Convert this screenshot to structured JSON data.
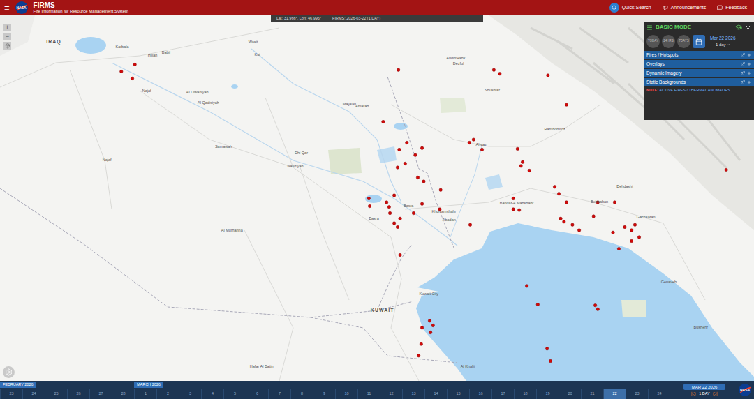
{
  "header": {
    "menu_icon": "≡",
    "logo": "NASA",
    "title": "FIRMS",
    "subtitle": "Fire Information for Resource Management System",
    "links": [
      "Quick Search",
      "Announcements",
      "Feedback"
    ]
  },
  "info_bar": {
    "coords": "Lat: 31.966°, Lon: 46.996°",
    "layer": "FIRMS: 2026-03-22 (1 DAY)"
  },
  "zoom": {
    "in": "+",
    "out": "−"
  },
  "panel": {
    "title": "BASIC MODE",
    "range_buttons": [
      {
        "label": "TODAY",
        "selected": false
      },
      {
        "label": "24HRS",
        "selected": false
      },
      {
        "label": "7DAYS",
        "selected": false
      }
    ],
    "calendar_selected": true,
    "date": "Mar 22 2026",
    "span": "1 day",
    "sections": [
      "Fires / Hotspots",
      "Overlays",
      "Dynamic Imagery",
      "Static Backgrounds"
    ],
    "note_label": "NOTE:",
    "note_text": "ACTIVE FIRES / THERMAL ANOMALIES"
  },
  "labels": [
    {
      "text": "IRAQ",
      "kind": "country",
      "lat": 32.68,
      "lon": 43.21
    },
    {
      "text": "Karbala",
      "kind": "city",
      "lat": 32.6,
      "lon": 44.02
    },
    {
      "text": "Hillah",
      "kind": "city",
      "lat": 32.49,
      "lon": 44.38
    },
    {
      "text": "Babil",
      "kind": "city",
      "lat": 32.53,
      "lon": 44.54
    },
    {
      "text": "Najaf",
      "kind": "city",
      "lat": 32.03,
      "lon": 44.31
    },
    {
      "text": "Al Diwaniyah",
      "kind": "city",
      "lat": 32.01,
      "lon": 44.91
    },
    {
      "text": "Al Qadisiyah",
      "kind": "city",
      "lat": 31.88,
      "lon": 45.04
    },
    {
      "text": "Wasit",
      "kind": "city",
      "lat": 32.66,
      "lon": 45.57
    },
    {
      "text": "Kut",
      "kind": "city",
      "lat": 32.5,
      "lon": 45.62
    },
    {
      "text": "Samawah",
      "kind": "city",
      "lat": 31.31,
      "lon": 45.22
    },
    {
      "text": "Dhi Qar",
      "kind": "city",
      "lat": 31.23,
      "lon": 46.14
    },
    {
      "text": "Nasiriyah",
      "kind": "city",
      "lat": 31.06,
      "lon": 46.07
    },
    {
      "text": "Najaf",
      "kind": "city",
      "lat": 31.14,
      "lon": 43.84
    },
    {
      "text": "Al Muthanna",
      "kind": "city",
      "lat": 30.23,
      "lon": 45.32
    },
    {
      "text": "Maysan",
      "kind": "city",
      "lat": 31.86,
      "lon": 46.71
    },
    {
      "text": "Amarah",
      "kind": "city",
      "lat": 31.83,
      "lon": 46.86
    },
    {
      "text": "Basra",
      "kind": "city",
      "lat": 30.55,
      "lon": 47.41
    },
    {
      "text": "Basra",
      "kind": "city",
      "lat": 30.38,
      "lon": 47.0
    },
    {
      "text": "Khorramshahr",
      "kind": "city",
      "lat": 30.47,
      "lon": 47.83
    },
    {
      "text": "Abadan",
      "kind": "city",
      "lat": 30.37,
      "lon": 47.89
    },
    {
      "text": "Ahvaz",
      "kind": "city",
      "lat": 31.34,
      "lon": 48.27
    },
    {
      "text": "Bandar-e Mahshahr",
      "kind": "city",
      "lat": 30.58,
      "lon": 48.69
    },
    {
      "text": "Andimeshk",
      "kind": "city",
      "lat": 32.46,
      "lon": 47.97
    },
    {
      "text": "Dezful",
      "kind": "city",
      "lat": 32.38,
      "lon": 48.0
    },
    {
      "text": "Shushtar",
      "kind": "city",
      "lat": 32.04,
      "lon": 48.4
    },
    {
      "text": "KUWAIT",
      "kind": "country",
      "lat": 29.21,
      "lon": 47.1
    },
    {
      "text": "Kuwait City",
      "kind": "city",
      "lat": 29.41,
      "lon": 47.65
    },
    {
      "text": "Al Khafji",
      "kind": "city",
      "lat": 28.47,
      "lon": 48.11
    },
    {
      "text": "Hafar Al Batin",
      "kind": "city",
      "lat": 28.47,
      "lon": 45.67
    },
    {
      "text": "Bushehr",
      "kind": "city",
      "lat": 28.98,
      "lon": 50.87
    },
    {
      "text": "Behbahan",
      "kind": "city",
      "lat": 30.6,
      "lon": 49.67
    },
    {
      "text": "Ramhormoz",
      "kind": "city",
      "lat": 31.54,
      "lon": 49.14
    },
    {
      "text": "Dehdasht",
      "kind": "city",
      "lat": 30.8,
      "lon": 49.97
    },
    {
      "text": "Gachsaran",
      "kind": "city",
      "lat": 30.4,
      "lon": 50.22
    },
    {
      "text": "Genaveh",
      "kind": "city",
      "lat": 29.56,
      "lon": 50.49
    }
  ],
  "fires": [
    {
      "lat": 32.29,
      "lon": 44.01
    },
    {
      "lat": 32.38,
      "lon": 44.17
    },
    {
      "lat": 32.2,
      "lon": 44.14
    },
    {
      "lat": 32.31,
      "lon": 47.29
    },
    {
      "lat": 31.64,
      "lon": 47.11
    },
    {
      "lat": 31.28,
      "lon": 47.3
    },
    {
      "lat": 31.37,
      "lon": 47.39
    },
    {
      "lat": 31.21,
      "lon": 47.49
    },
    {
      "lat": 31.3,
      "lon": 47.57
    },
    {
      "lat": 31.05,
      "lon": 47.28
    },
    {
      "lat": 31.1,
      "lon": 47.37
    },
    {
      "lat": 30.92,
      "lon": 47.52
    },
    {
      "lat": 30.87,
      "lon": 47.59
    },
    {
      "lat": 30.76,
      "lon": 47.79
    },
    {
      "lat": 31.37,
      "lon": 48.13
    },
    {
      "lat": 31.41,
      "lon": 48.18
    },
    {
      "lat": 31.28,
      "lon": 48.28
    },
    {
      "lat": 32.31,
      "lon": 48.42
    },
    {
      "lat": 32.26,
      "lon": 48.49
    },
    {
      "lat": 31.29,
      "lon": 48.7
    },
    {
      "lat": 31.07,
      "lon": 48.74
    },
    {
      "lat": 31.12,
      "lon": 48.76
    },
    {
      "lat": 31.01,
      "lon": 48.84
    },
    {
      "lat": 30.51,
      "lon": 47.78
    },
    {
      "lat": 30.65,
      "lon": 46.94
    },
    {
      "lat": 30.55,
      "lon": 46.95
    },
    {
      "lat": 30.6,
      "lon": 47.15
    },
    {
      "lat": 30.54,
      "lon": 47.18
    },
    {
      "lat": 30.46,
      "lon": 47.19
    },
    {
      "lat": 30.33,
      "lon": 47.24
    },
    {
      "lat": 30.28,
      "lon": 47.28
    },
    {
      "lat": 30.39,
      "lon": 47.31
    },
    {
      "lat": 30.69,
      "lon": 47.24
    },
    {
      "lat": 30.46,
      "lon": 47.47
    },
    {
      "lat": 30.58,
      "lon": 47.57
    },
    {
      "lat": 30.31,
      "lon": 48.14
    },
    {
      "lat": 30.51,
      "lon": 48.65
    },
    {
      "lat": 30.65,
      "lon": 48.65
    },
    {
      "lat": 30.5,
      "lon": 48.72
    },
    {
      "lat": 30.8,
      "lon": 49.14
    },
    {
      "lat": 30.71,
      "lon": 49.19
    },
    {
      "lat": 30.39,
      "lon": 49.21
    },
    {
      "lat": 30.35,
      "lon": 49.25
    },
    {
      "lat": 30.6,
      "lon": 49.28
    },
    {
      "lat": 30.31,
      "lon": 49.35
    },
    {
      "lat": 30.24,
      "lon": 49.43
    },
    {
      "lat": 30.42,
      "lon": 49.6
    },
    {
      "lat": 30.6,
      "lon": 49.65
    },
    {
      "lat": 30.21,
      "lon": 49.83
    },
    {
      "lat": 30.0,
      "lon": 49.9
    },
    {
      "lat": 30.28,
      "lon": 49.97
    },
    {
      "lat": 30.24,
      "lon": 50.05
    },
    {
      "lat": 30.31,
      "lon": 50.09
    },
    {
      "lat": 30.1,
      "lon": 50.05
    },
    {
      "lat": 30.15,
      "lon": 50.14
    },
    {
      "lat": 30.6,
      "lon": 49.85
    },
    {
      "lat": 31.02,
      "lon": 51.17
    },
    {
      "lat": 29.28,
      "lon": 48.94
    },
    {
      "lat": 29.27,
      "lon": 49.62
    },
    {
      "lat": 29.22,
      "lon": 49.65
    },
    {
      "lat": 29.52,
      "lon": 48.81
    },
    {
      "lat": 29.07,
      "lon": 47.66
    },
    {
      "lat": 29.01,
      "lon": 47.7
    },
    {
      "lat": 28.98,
      "lon": 47.57
    },
    {
      "lat": 28.92,
      "lon": 47.67
    },
    {
      "lat": 28.77,
      "lon": 47.56
    },
    {
      "lat": 28.62,
      "lon": 47.53
    },
    {
      "lat": 28.55,
      "lon": 49.09
    },
    {
      "lat": 28.71,
      "lon": 49.05
    },
    {
      "lat": 29.92,
      "lon": 47.31
    },
    {
      "lat": 32.24,
      "lon": 49.06
    },
    {
      "lat": 31.86,
      "lon": 49.28
    }
  ],
  "timeline": {
    "months": [
      {
        "label": "FEBRUARY 2026",
        "days": [
          {
            "label": "23",
            "selected": false
          },
          {
            "label": "24",
            "selected": false
          },
          {
            "label": "25",
            "selected": false
          },
          {
            "label": "26",
            "selected": false
          },
          {
            "label": "27",
            "selected": false
          },
          {
            "label": "28",
            "selected": false
          }
        ]
      },
      {
        "label": "MARCH 2026",
        "days": [
          {
            "label": "1",
            "selected": false
          },
          {
            "label": "2",
            "selected": false
          },
          {
            "label": "3",
            "selected": false
          },
          {
            "label": "4",
            "selected": false
          },
          {
            "label": "5",
            "selected": false
          },
          {
            "label": "6",
            "selected": false
          },
          {
            "label": "7",
            "selected": false
          },
          {
            "label": "8",
            "selected": false
          },
          {
            "label": "9",
            "selected": false
          },
          {
            "label": "10",
            "selected": false
          },
          {
            "label": "11",
            "selected": false
          },
          {
            "label": "12",
            "selected": false
          },
          {
            "label": "13",
            "selected": false
          },
          {
            "label": "14",
            "selected": false
          },
          {
            "label": "15",
            "selected": false
          },
          {
            "label": "16",
            "selected": false
          },
          {
            "label": "17",
            "selected": false
          },
          {
            "label": "18",
            "selected": false
          },
          {
            "label": "19",
            "selected": false
          },
          {
            "label": "20",
            "selected": false
          },
          {
            "label": "21",
            "selected": false
          },
          {
            "label": "22",
            "selected": true
          },
          {
            "label": "23",
            "selected": false
          },
          {
            "label": "24",
            "selected": false
          }
        ]
      }
    ],
    "current_date": "MAR 22 2026",
    "span": "1 DAY",
    "logo": "NASA"
  }
}
